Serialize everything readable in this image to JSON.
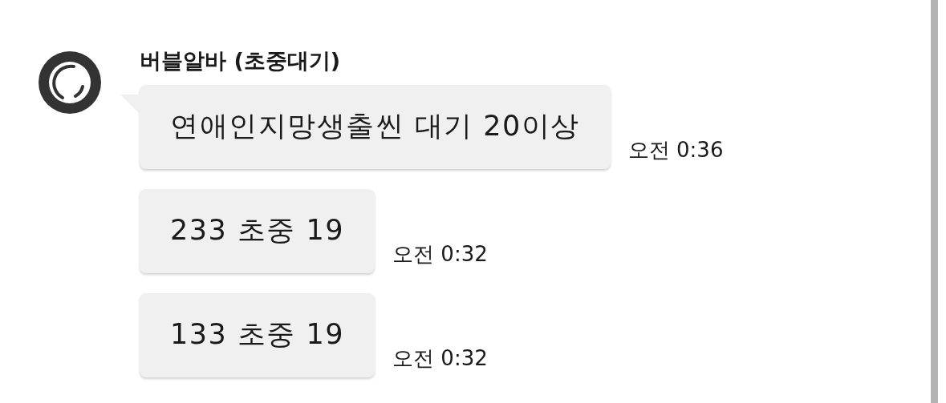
{
  "sender": {
    "name": "버블알바 (초중대기)"
  },
  "messages": [
    {
      "text": "연애인지망생출씬 대기 20이상",
      "time": "오전 0:36"
    },
    {
      "text": "233 초중 19",
      "time": "오전 0:32"
    },
    {
      "text": "133 초중 19",
      "time": "오전 0:32"
    }
  ]
}
